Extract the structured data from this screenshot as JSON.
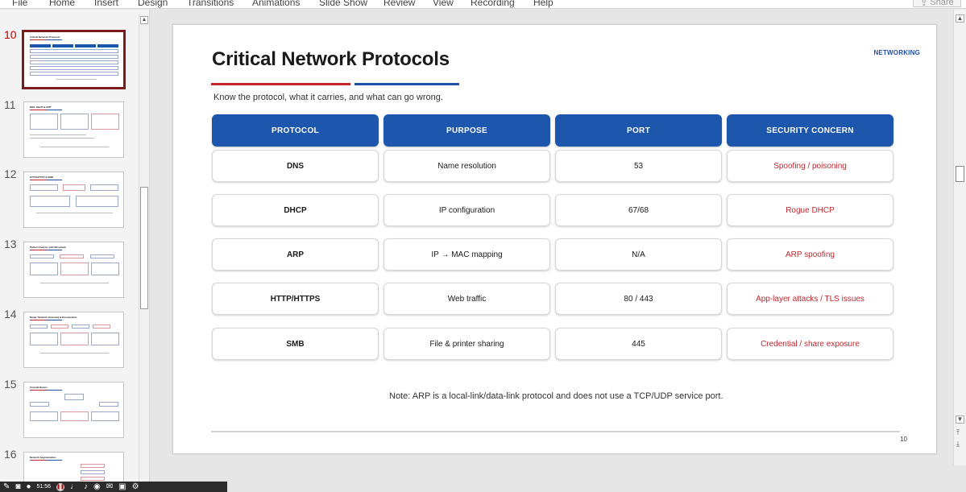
{
  "menu": {
    "items": [
      "File",
      "Home",
      "Insert",
      "Design",
      "Transitions",
      "Animations",
      "Slide Show",
      "Review",
      "View",
      "Recording",
      "Help"
    ],
    "share_label": "Share"
  },
  "thumbnails": [
    {
      "number": "10",
      "title": "Critical Network Protocols",
      "active": true
    },
    {
      "number": "11",
      "title": "DNS, DHCP & ARP",
      "active": false
    },
    {
      "number": "12",
      "title": "HTTP/HTTPS & SMB",
      "active": false
    },
    {
      "number": "13",
      "title": "Packet Analysis with Wireshark",
      "active": false
    },
    {
      "number": "14",
      "title": "Nmap: Network Scanning & Enumeration",
      "active": false
    },
    {
      "number": "15",
      "title": "Firewall Basics",
      "active": false
    },
    {
      "number": "16",
      "title": "Network Segmentation",
      "active": false
    }
  ],
  "slide": {
    "title": "Critical Network Protocols",
    "category": "NETWORKING",
    "subtitle": "Know the protocol, what it carries, and what can go wrong.",
    "headers": [
      "PROTOCOL",
      "PURPOSE",
      "PORT",
      "SECURITY CONCERN"
    ],
    "rows": [
      [
        "DNS",
        "Name resolution",
        "53",
        "Spoofing / poisoning"
      ],
      [
        "DHCP",
        "IP configuration",
        "67/68",
        "Rogue DHCP"
      ],
      [
        "ARP",
        "IP → MAC mapping",
        "N/A",
        "ARP spoofing"
      ],
      [
        "HTTP/HTTPS",
        "Web traffic",
        "80 / 443",
        "App-layer attacks / TLS issues"
      ],
      [
        "SMB",
        "File & printer sharing",
        "445",
        "Credential / share exposure"
      ]
    ],
    "note": "Note: ARP is a local-link/data-link protocol and does not use a TCP/UDP service port.",
    "page_number": "10"
  },
  "recording": {
    "time": "51:56"
  },
  "colors": {
    "accent_red": "#c0282e",
    "accent_blue": "#1f4fa8",
    "header_fill": "#1d56ad"
  }
}
